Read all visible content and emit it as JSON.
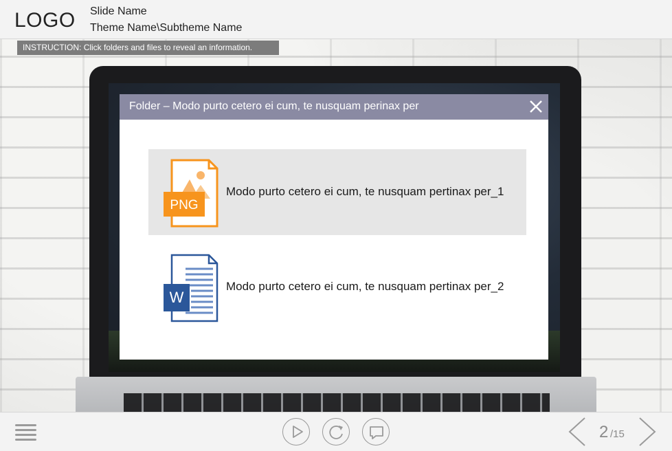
{
  "header": {
    "logo": "LOGO",
    "slide_name": "Slide Name",
    "theme_name": "Theme Name\\Subtheme Name"
  },
  "instruction": {
    "label": "INSTRUCTION:",
    "text": "Click folders and files to reveal an information."
  },
  "dialog": {
    "title": "Folder – Modo purto cetero ei cum, te nusquam perinax per",
    "close_icon": "close-icon",
    "files": [
      {
        "icon": "png-file-icon",
        "icon_text": "PNG",
        "label": "Modo purto cetero ei cum, te nusquam pertinax per_1",
        "selected": true
      },
      {
        "icon": "word-file-icon",
        "icon_text": "W",
        "label": "Modo purto cetero ei cum, te nusquam pertinax per_2",
        "selected": false
      }
    ]
  },
  "footer": {
    "menu_icon": "menu-icon",
    "play_icon": "play-icon",
    "replay_icon": "replay-icon",
    "comment_icon": "comment-icon",
    "prev_icon": "chevron-left-icon",
    "next_icon": "chevron-right-icon",
    "page_current": "2",
    "page_total": "/15"
  },
  "colors": {
    "dialog_titlebar": "#8a8aa3",
    "png_orange": "#f7941d",
    "word_blue": "#2b579a",
    "selected_row": "#e6e6e6"
  }
}
